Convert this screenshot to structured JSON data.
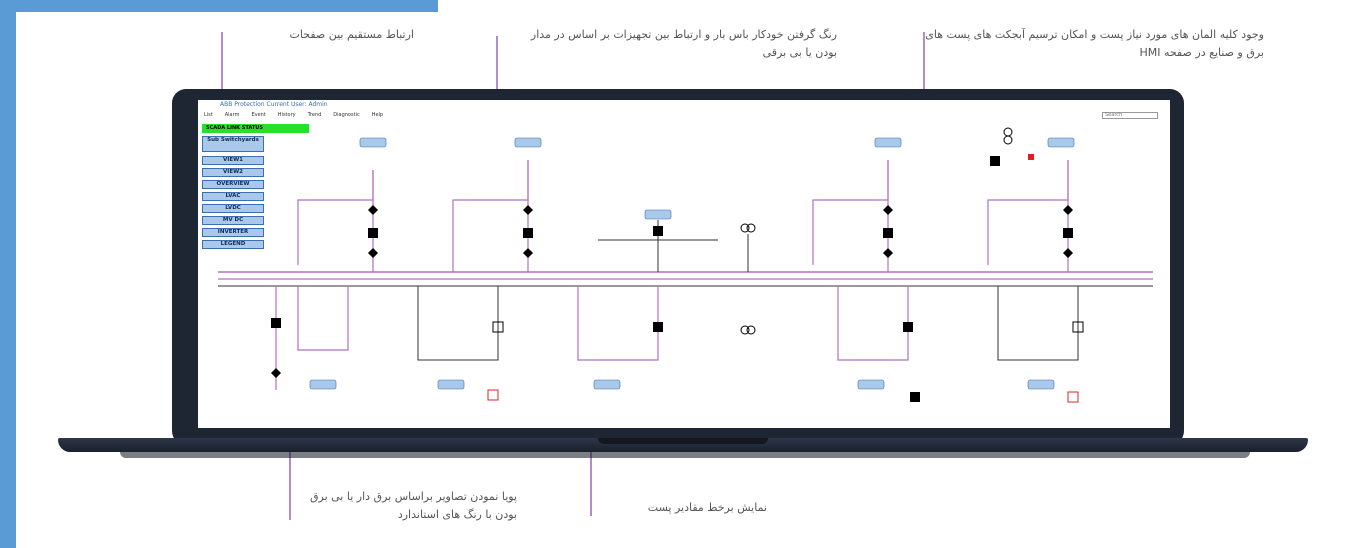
{
  "callouts": {
    "page_link": "ارتباط مستقیم بین صفحات",
    "bus_coloring": "رنگ گرفتن خودکار باس بار و ارتباط بین تجهیزات بر اساس در مدار بودن یا بی برقی",
    "all_elements": "وجود کلیه المان های مورد نیاز پست و امکان ترسیم آبجکت های پست های برق و صنایع در صفحه HMI",
    "dynamic_images": "پویا نمودن تصاویر براساس برق دار یا بی برق بودن با رنگ های استاندارد",
    "live_values": "نمایش برخط مقادیر پست"
  },
  "app": {
    "title": "ABB Protection  Current User:  Admin",
    "menu": [
      "List",
      "Alarm",
      "Event",
      "History",
      "Trend",
      "Diagnostic",
      "Help"
    ],
    "search_placeholder": "Search",
    "scada_status": "SCADA LINK STATUS",
    "nav_buttons": [
      "Sub Switchyards",
      "VIEW1",
      "VIEW2",
      "OVERVIEW",
      "LVAC",
      "LVDC",
      "MV DC",
      "INVERTER",
      "LEGEND"
    ]
  },
  "colors": {
    "accent": "#5b9bd5",
    "energized_line": "#b070c0",
    "deenergized_line": "#333333",
    "status_green": "#28e028",
    "alarm_red": "#e02020",
    "callout_line": "#b58bd0"
  }
}
